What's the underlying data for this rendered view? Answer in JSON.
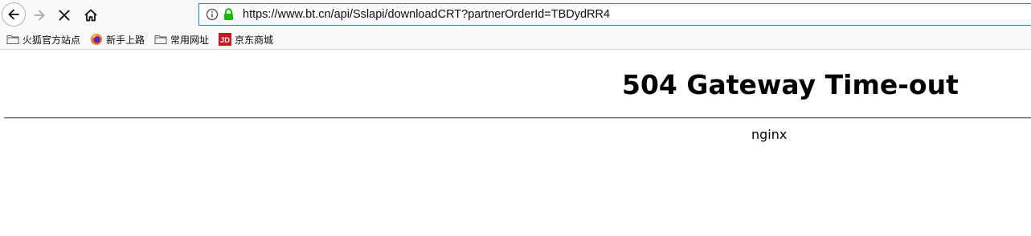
{
  "browser": {
    "url": "https://www.bt.cn/api/Sslapi/downloadCRT?partnerOrderId=TBDydRR4",
    "icons": {
      "back": "back-arrow-icon",
      "forward": "forward-arrow-icon",
      "stop": "stop-loading-icon",
      "home": "home-icon",
      "info": "site-info-icon",
      "lock": "secure-lock-icon"
    },
    "accent_color": "#0a84ff",
    "lock_color": "#12bc00"
  },
  "bookmarks": [
    {
      "label": "火狐官方站点",
      "icon": "folder-icon"
    },
    {
      "label": "新手上路",
      "icon": "firefox-icon"
    },
    {
      "label": "常用网址",
      "icon": "folder-icon"
    },
    {
      "label": "京东商城",
      "icon": "jd-icon"
    }
  ],
  "page": {
    "title": "504 Gateway Time-out",
    "server": "nginx"
  }
}
